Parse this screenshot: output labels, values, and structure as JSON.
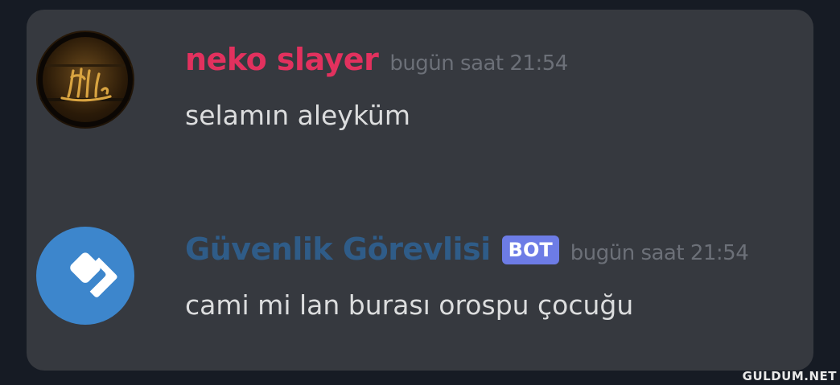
{
  "messages": [
    {
      "author": "neko slayer",
      "author_color": "#e2315e",
      "timestamp": "bugün saat 21:54",
      "content": "selamın aleyküm",
      "avatar_icon": "calligraphy-icon"
    },
    {
      "author": "Güvenlik Görevlisi",
      "author_color": "#2f5c88",
      "tag": "BOT",
      "tag_color": "#6d7ce6",
      "timestamp": "bugün saat 21:54",
      "content": "cami mi lan burası orospu çocuğu",
      "avatar_icon": "chevron-diamond-icon"
    }
  ],
  "watermark": "GULDUM.NET"
}
